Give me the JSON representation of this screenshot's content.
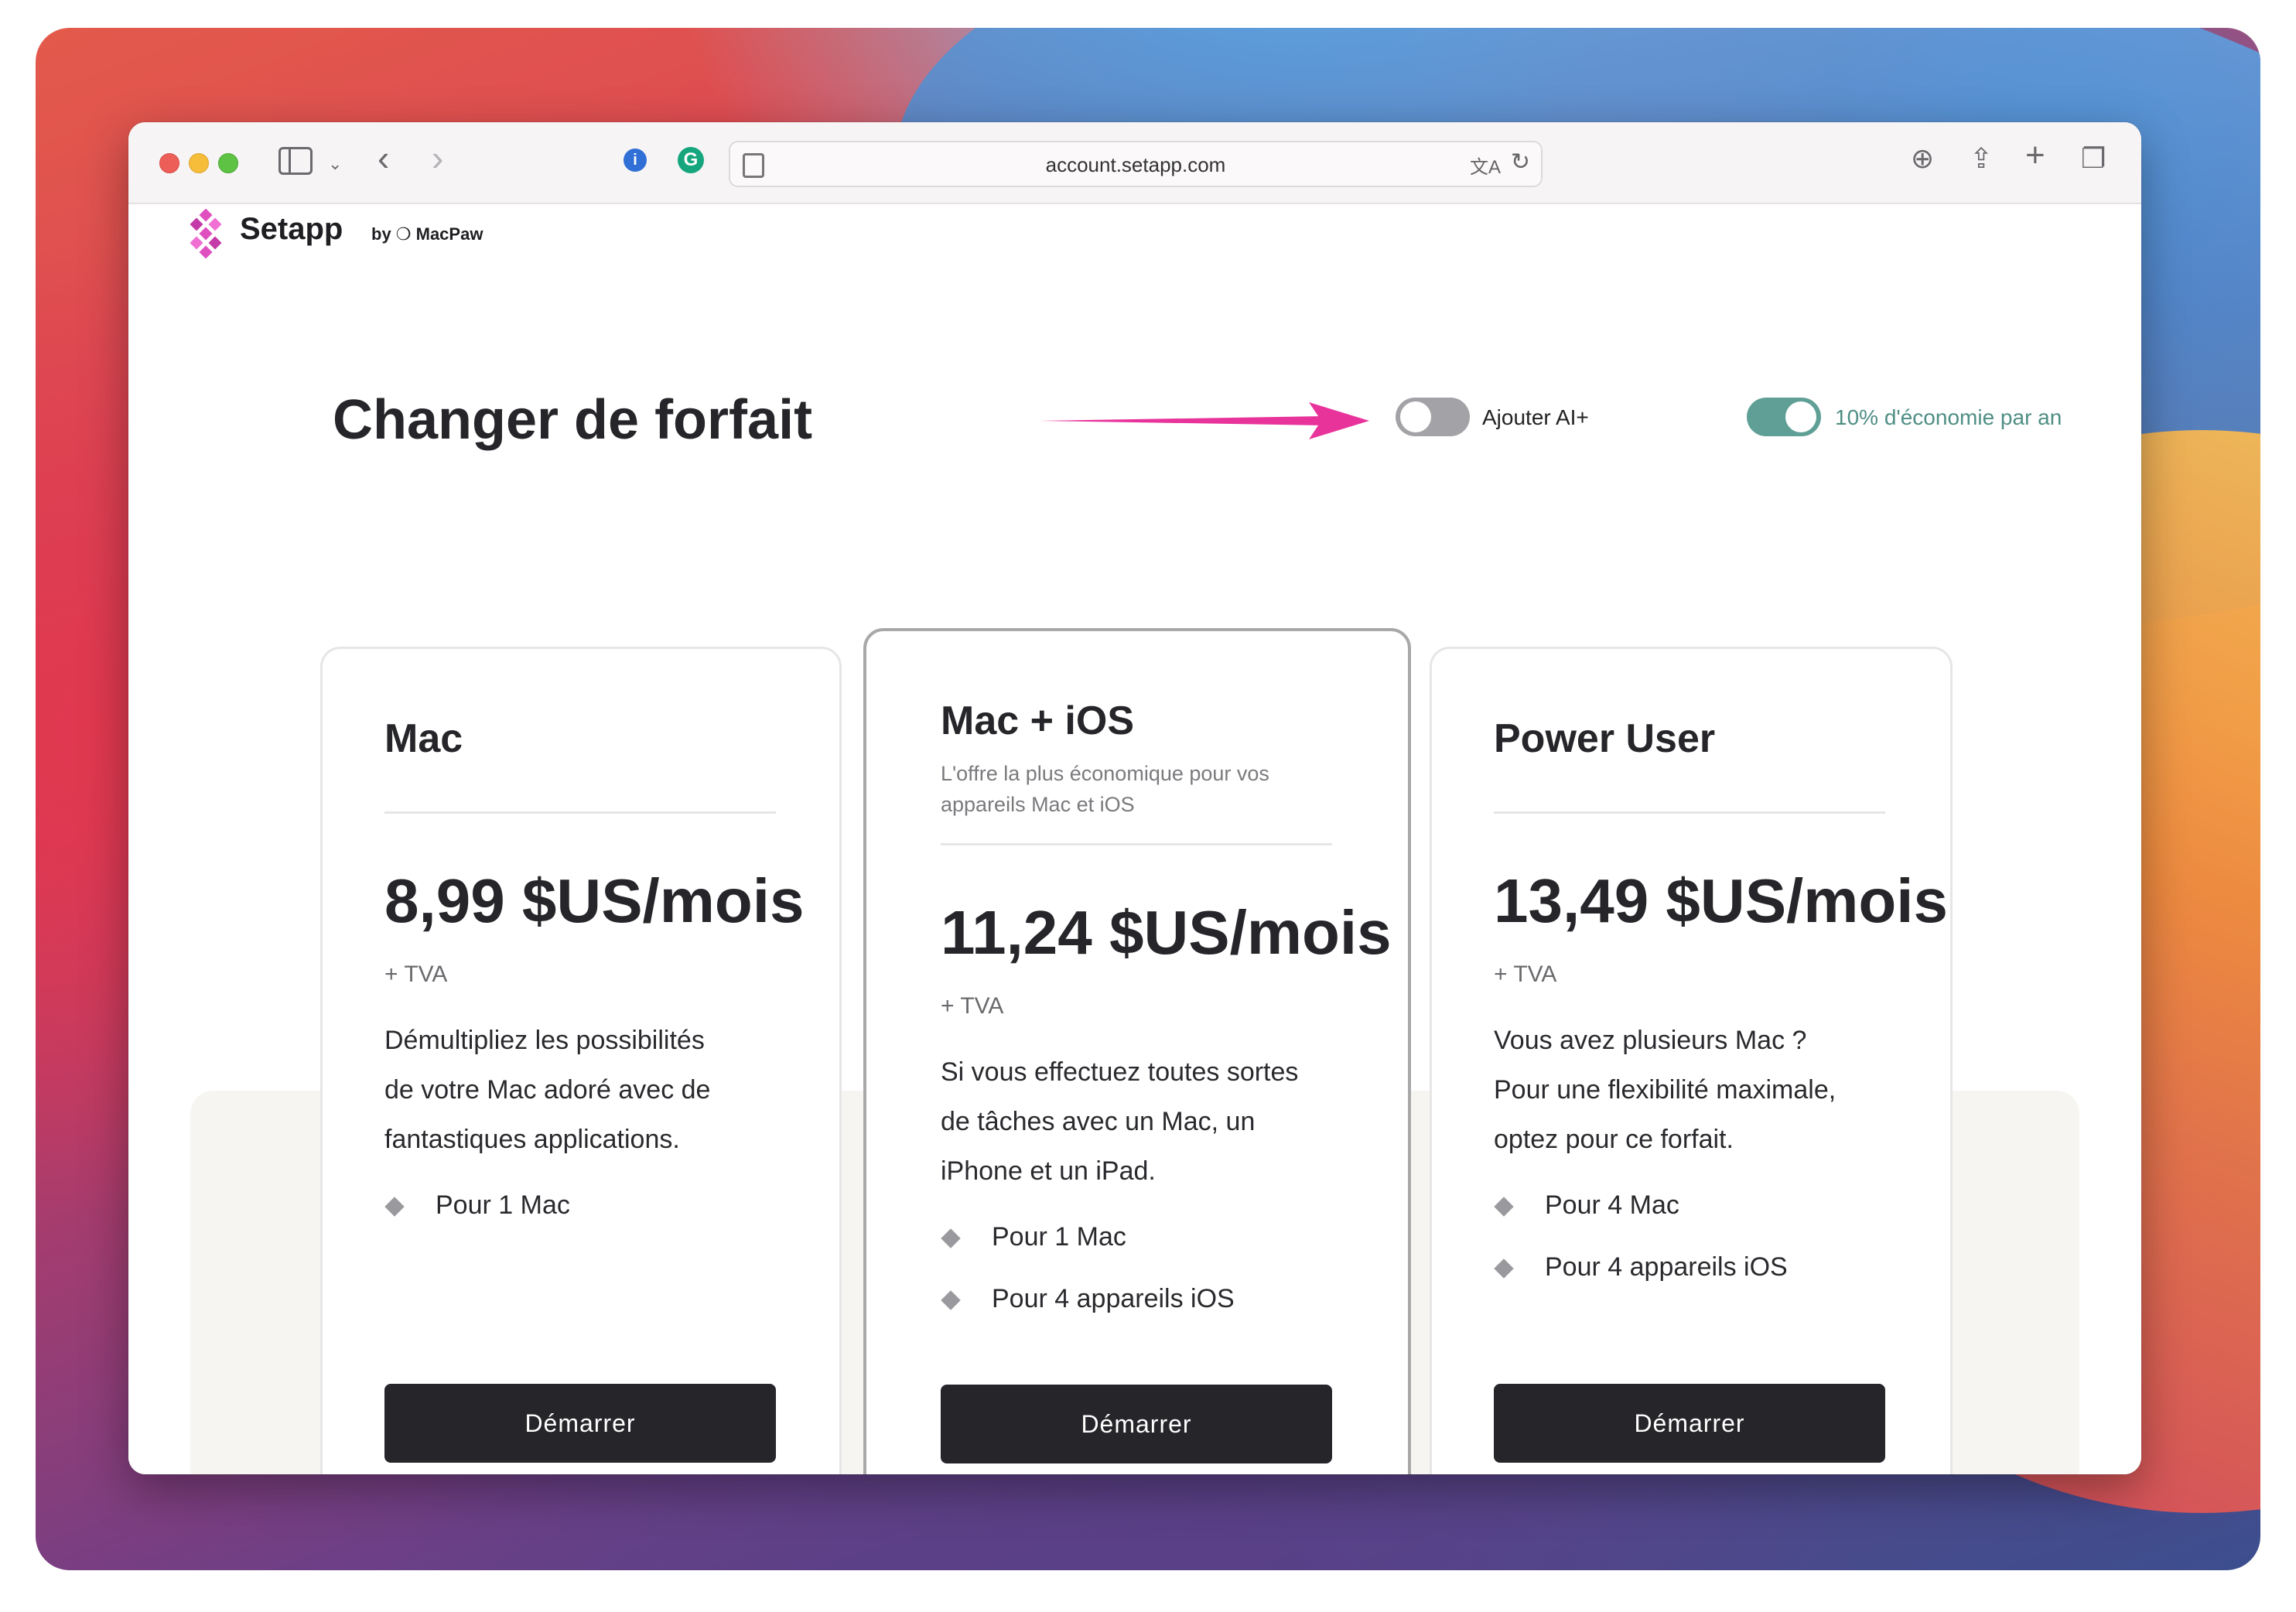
{
  "browser": {
    "url": "account.setapp.com"
  },
  "header": {
    "brand": "Setapp",
    "by_label": "by ❍ MacPaw"
  },
  "page": {
    "title": "Changer de forfait",
    "toggle_ai_label": "Ajouter AI+",
    "toggle_ai_on": false,
    "toggle_savings_label": "10% d'économie par an",
    "toggle_savings_on": true,
    "accent_color": "#5f9f95",
    "arrow_color": "#e8339b"
  },
  "plans": [
    {
      "name": "Mac",
      "subtitle": "",
      "price": "8,99 $US/mois",
      "vat": "+ TVA",
      "desc": [
        "Démultipliez les possibilités",
        "de votre Mac adoré avec de",
        "fantastiques applications."
      ],
      "features": [
        "Pour 1 Mac"
      ],
      "button": "Démarrer"
    },
    {
      "name": "Mac + iOS",
      "subtitle": [
        "L'offre la plus économique pour vos",
        "appareils Mac et iOS"
      ],
      "price": "11,24 $US/mois",
      "vat": "+ TVA",
      "desc": [
        "Si vous effectuez toutes sortes",
        "de tâches avec un Mac, un",
        "iPhone et un iPad."
      ],
      "features": [
        "Pour 1 Mac",
        "Pour 4 appareils iOS"
      ],
      "button": "Démarrer"
    },
    {
      "name": "Power User",
      "subtitle": "",
      "price": "13,49 $US/mois",
      "vat": "+ TVA",
      "desc": [
        "Vous avez plusieurs Mac ?",
        "Pour une flexibilité maximale,",
        "optez pour ce forfait."
      ],
      "features": [
        "Pour 4 Mac",
        "Pour 4 appareils iOS"
      ],
      "button": "Démarrer"
    }
  ]
}
